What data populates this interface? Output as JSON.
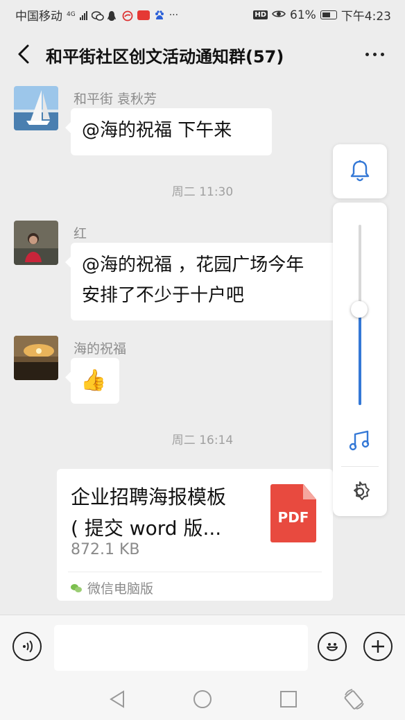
{
  "status_bar": {
    "carrier": "中国移动",
    "network": "4G",
    "battery_percent": "61%",
    "time": "下午4:23",
    "hd_label": "HD"
  },
  "header": {
    "title": "和平街社区创文活动通知群(57)"
  },
  "messages": [
    {
      "sender": "和平街  袁秋芳",
      "text": "@海的祝福   下午来"
    },
    {
      "type": "time",
      "text": "周二 11:30"
    },
    {
      "sender": "红",
      "text_line1": "@海的祝福 ，花园广场今年",
      "text_line2": "安排了不少于十户吧"
    },
    {
      "sender": "海的祝福",
      "emoji": "👍"
    },
    {
      "type": "time",
      "text": "周二 16:14"
    }
  ],
  "file_card": {
    "name_line1": "企业招聘海报模板",
    "name_line2": "( 提交 word 版...",
    "size": "872.1 KB",
    "icon_label": "PDF",
    "source": "微信电脑版"
  },
  "volume_panel": {
    "level": 0.53
  },
  "colors": {
    "accent": "#3478d6",
    "pdf_red": "#e84a3f",
    "background": "#ededed"
  }
}
